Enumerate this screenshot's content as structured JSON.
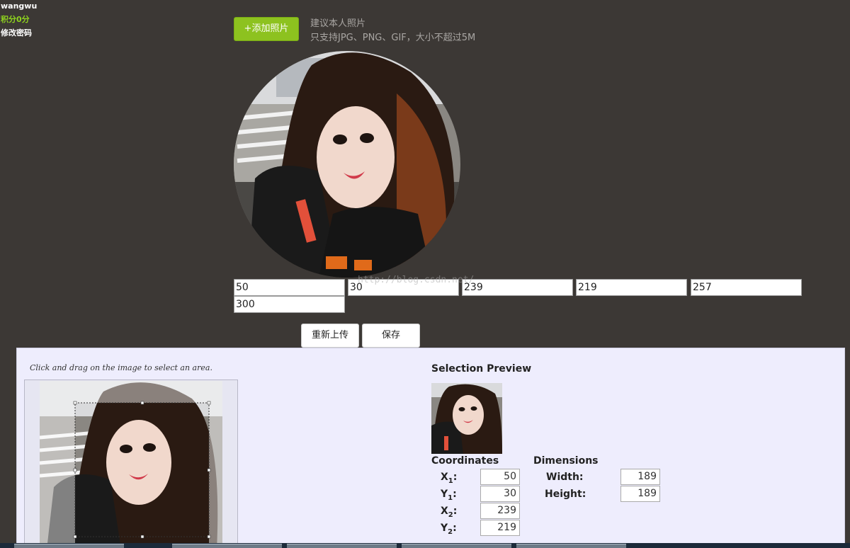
{
  "user": {
    "name": "wangwu",
    "points": "积分0分",
    "change_password": "修改密码"
  },
  "upload": {
    "button": "+添加照片",
    "hint_line1": "建议本人照片",
    "hint_line2": "只支持JPG、PNG、GIF，大小不超过5M"
  },
  "coord_values": [
    "50",
    "30",
    "239",
    "219",
    "257",
    "300"
  ],
  "watermark": "http://blog.csdn.net/",
  "actions": {
    "reupload": "重新上传",
    "save": "保存"
  },
  "jcrop": {
    "instruction": "Click and drag on the image to select an area.",
    "preview_title": "Selection Preview",
    "coordinates_title": "Coordinates",
    "dimensions_title": "Dimensions",
    "x1": "50",
    "y1": "30",
    "x2": "239",
    "y2": "219",
    "width_label": "Width:",
    "width": "189",
    "height_label": "Height:",
    "height": "189"
  },
  "colors": {
    "accent": "#8dc21f",
    "background": "#3c3835",
    "panel": "#eeedfd"
  }
}
